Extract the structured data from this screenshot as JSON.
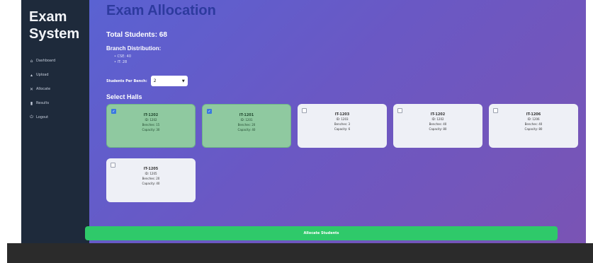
{
  "sidebar": {
    "brand_line1": "Exam",
    "brand_line2": "System",
    "items": [
      {
        "icon": "home-icon",
        "glyph": "⌂",
        "label": "Dashboard"
      },
      {
        "icon": "upload-icon",
        "glyph": "▴",
        "label": "Upload"
      },
      {
        "icon": "allocate-icon",
        "glyph": "✕",
        "label": "Allocate"
      },
      {
        "icon": "results-icon",
        "glyph": "▮",
        "label": "Results"
      },
      {
        "icon": "logout-icon",
        "glyph": "⏻",
        "label": "Logout"
      }
    ]
  },
  "main": {
    "title": "Exam Allocation",
    "total_students": "Total Students: 68",
    "branch_title": "Branch Distribution:",
    "branches": [
      "CSE: 40",
      "IT: 28"
    ],
    "students_per_bench_label": "Students Per Bench:",
    "students_per_bench_value": "2",
    "select_halls_label": "Select Halls",
    "halls": [
      {
        "name": "IT-1202",
        "id": "ID: 1202",
        "benches": "Benches: 15",
        "capacity": "Capacity: 30",
        "selected": true
      },
      {
        "name": "IT-1201",
        "id": "ID: 1201",
        "benches": "Benches: 20",
        "capacity": "Capacity: 40",
        "selected": true
      },
      {
        "name": "IT-1203",
        "id": "ID: 1203",
        "benches": "Benches: 3",
        "capacity": "Capacity: 6",
        "selected": false
      },
      {
        "name": "IT-1202",
        "id": "ID: 1202",
        "benches": "Benches: 40",
        "capacity": "Capacity: 80",
        "selected": false
      },
      {
        "name": "IT-1206",
        "id": "ID: 1206",
        "benches": "Benches: 40",
        "capacity": "Capacity: 80",
        "selected": false
      },
      {
        "name": "IT-1205",
        "id": "ID: 1205",
        "benches": "Benches: 20",
        "capacity": "Capacity: 40",
        "selected": false
      }
    ],
    "allocate_button": "Allocate Students"
  },
  "colors": {
    "sidebar_bg": "#1e2a3b",
    "title": "#2d3a9e",
    "selected_card": "#8fc9a0",
    "allocate_button": "#2fc96a"
  }
}
